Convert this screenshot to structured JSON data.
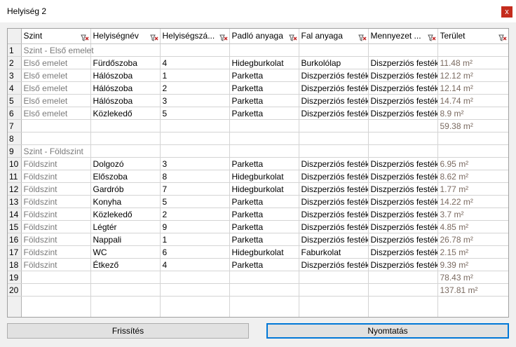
{
  "window": {
    "title": "Helyiség 2",
    "close_label": "x"
  },
  "table": {
    "columns": [
      "Szint",
      "Helyiségnév",
      "Helyiségszá...",
      "Padló anyaga",
      "Fal anyaga",
      "Mennyezet ...",
      "Terület"
    ],
    "rows": [
      {
        "num": "1",
        "cells": [
          "Szint - Első emelet",
          "",
          "",
          "",
          "",
          "",
          ""
        ],
        "group": true
      },
      {
        "num": "2",
        "cells": [
          "Első emelet",
          "Fürdőszoba",
          "4",
          "Hidegburkolat",
          "Burkolólap",
          "Diszperziós festék",
          "11.48 m²"
        ]
      },
      {
        "num": "3",
        "cells": [
          "Első emelet",
          "Hálószoba",
          "1",
          "Parketta",
          "Diszperziós festék",
          "Diszperziós festék",
          "12.12 m²"
        ]
      },
      {
        "num": "4",
        "cells": [
          "Első emelet",
          "Hálószoba",
          "2",
          "Parketta",
          "Diszperziós festék",
          "Diszperziós festék",
          "12.14 m²"
        ]
      },
      {
        "num": "5",
        "cells": [
          "Első emelet",
          "Hálószoba",
          "3",
          "Parketta",
          "Diszperziós festék",
          "Diszperziós festék",
          "14.74 m²"
        ]
      },
      {
        "num": "6",
        "cells": [
          "Első emelet",
          "Közlekedő",
          "5",
          "Parketta",
          "Diszperziós festék",
          "Diszperziós festék",
          "8.9 m²"
        ]
      },
      {
        "num": "7",
        "cells": [
          "",
          "",
          "",
          "",
          "",
          "",
          "59.38 m²"
        ]
      },
      {
        "num": "8",
        "cells": [
          "",
          "",
          "",
          "",
          "",
          "",
          ""
        ]
      },
      {
        "num": "9",
        "cells": [
          "Szint - Földszint",
          "",
          "",
          "",
          "",
          "",
          ""
        ],
        "group": true
      },
      {
        "num": "10",
        "cells": [
          "Földszint",
          "Dolgozó",
          "3",
          "Parketta",
          "Diszperziós festék",
          "Diszperziós festék",
          "6.95 m²"
        ]
      },
      {
        "num": "11",
        "cells": [
          "Földszint",
          "Előszoba",
          "8",
          "Hidegburkolat",
          "Diszperziós festék",
          "Diszperziós festék",
          "8.62 m²"
        ]
      },
      {
        "num": "12",
        "cells": [
          "Földszint",
          "Gardrób",
          "7",
          "Hidegburkolat",
          "Diszperziós festék",
          "Diszperziós festék",
          "1.77 m²"
        ]
      },
      {
        "num": "13",
        "cells": [
          "Földszint",
          "Konyha",
          "5",
          "Parketta",
          "Diszperziós festék",
          "Diszperziós festék",
          "14.22 m²"
        ]
      },
      {
        "num": "14",
        "cells": [
          "Földszint",
          "Közlekedő",
          "2",
          "Parketta",
          "Diszperziós festék",
          "Diszperziós festék",
          "3.7 m²"
        ]
      },
      {
        "num": "15",
        "cells": [
          "Földszint",
          "Légtér",
          "9",
          "Parketta",
          "Diszperziós festék",
          "Diszperziós festék",
          "4.85 m²"
        ]
      },
      {
        "num": "16",
        "cells": [
          "Földszint",
          "Nappali",
          "1",
          "Parketta",
          "Diszperziós festék",
          "Diszperziós festék",
          "26.78 m²"
        ]
      },
      {
        "num": "17",
        "cells": [
          "Földszint",
          "WC",
          "6",
          "Hidegburkolat",
          "Faburkolat",
          "Diszperziós festék",
          "2.15 m²"
        ]
      },
      {
        "num": "18",
        "cells": [
          "Földszint",
          "Étkező",
          "4",
          "Parketta",
          "Diszperziós festék",
          "Diszperziós festék",
          "9.39 m²"
        ]
      },
      {
        "num": "19",
        "cells": [
          "",
          "",
          "",
          "",
          "",
          "",
          "78.43 m²"
        ]
      },
      {
        "num": "20",
        "cells": [
          "",
          "",
          "",
          "",
          "",
          "",
          "137.81 m²"
        ]
      }
    ]
  },
  "buttons": {
    "refresh": "Frissítés",
    "print": "Nyomtatás"
  },
  "colors": {
    "filter_icon": "#c02020",
    "gray_text": "#7a7a7a",
    "accent": "#0078d7"
  },
  "icons": {
    "filter": "filter-icon",
    "close": "close-icon"
  }
}
